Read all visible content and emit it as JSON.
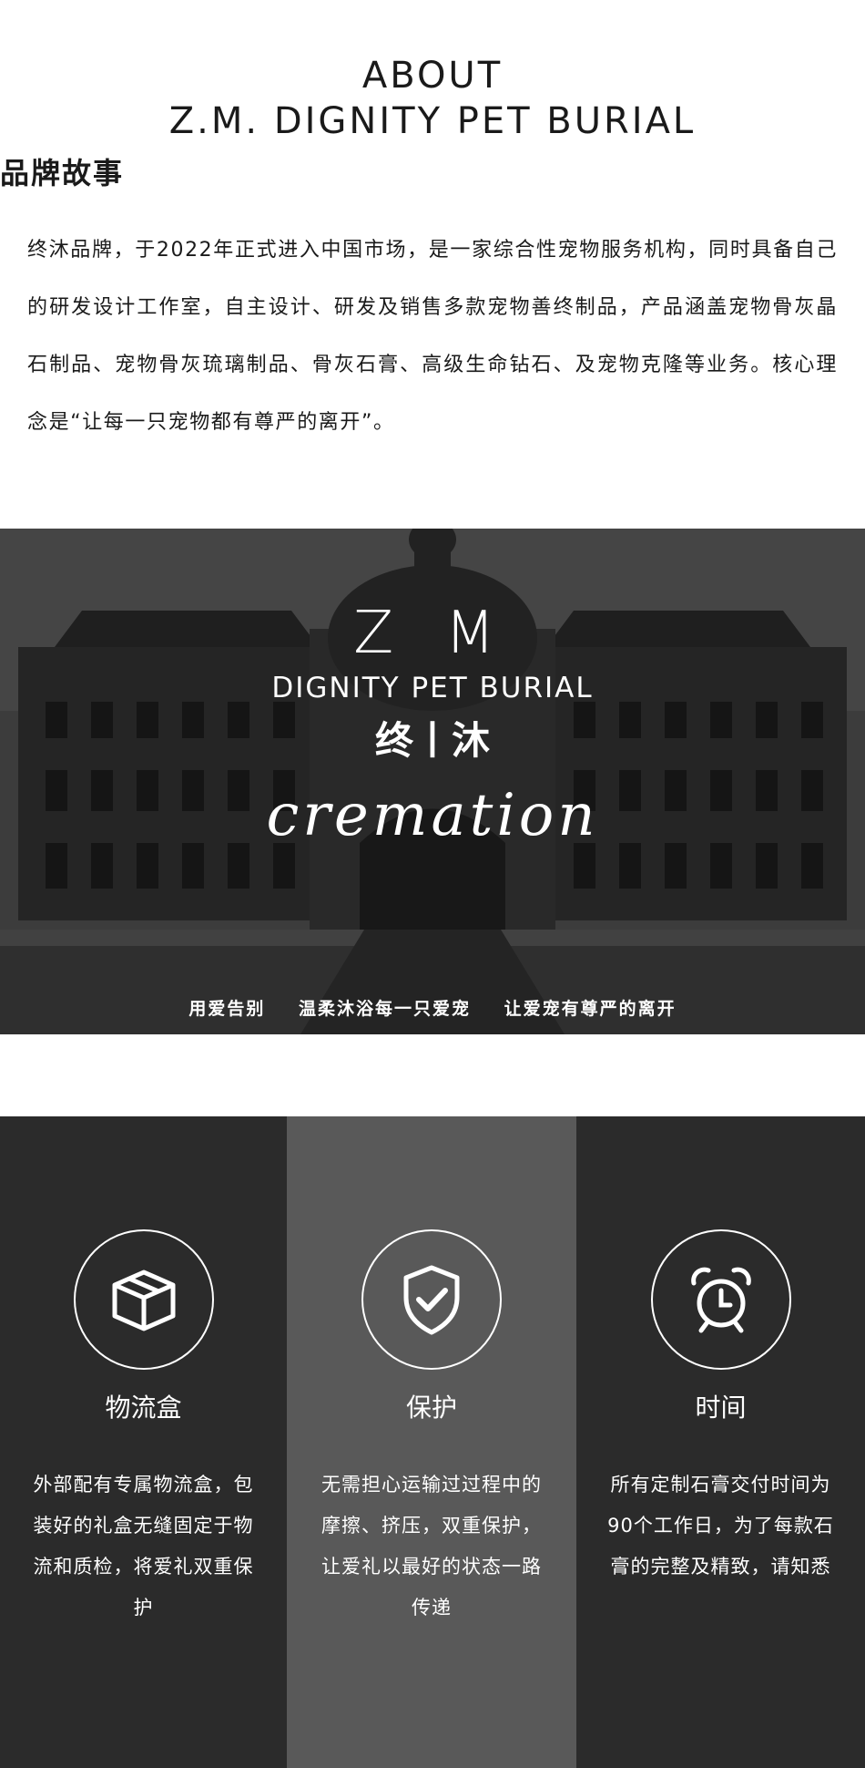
{
  "header": {
    "title_line1": "ABOUT",
    "title_line2": "Z.M. DIGNITY PET BURIAL",
    "title_cn": "品牌故事"
  },
  "intro": {
    "paragraph": "终沐品牌，于2022年正式进入中国市场，是一家综合性宠物服务机构，同时具备自己的研发设计工作室，自主设计、研发及销售多款宠物善终制品，产品涵盖宠物骨灰晶石制品、宠物骨灰琉璃制品、骨灰石膏、高级生命钻石、及宠物克隆等业务。核心理念是“让每一只宠物都有尊严的离开”。"
  },
  "banner": {
    "logo_zm": "Z M",
    "logo_en": "DIGNITY PET BURIAL",
    "logo_cn": "终丨沐",
    "logo_script": "cremation",
    "slogans": [
      "用爱告别",
      "温柔沐浴每一只爱宠",
      "让爱宠有尊严的离开"
    ]
  },
  "features": [
    {
      "icon": "box-icon",
      "title": "物流盒",
      "text": "外部配有专属物流盒，包装好的礼盒无缝固定于物流和质检，将爱礼双重保护"
    },
    {
      "icon": "shield-check-icon",
      "title": "保护",
      "text": "无需担心运输过过程中的摩擦、挤压，双重保护，让爱礼以最好的状态一路传递"
    },
    {
      "icon": "alarm-clock-icon",
      "title": "时间",
      "text": "所有定制石膏交付时间为90个工作日，为了每款石膏的完整及精致，请知悉"
    }
  ],
  "colors": {
    "dark_column": "#2b2b2b",
    "mid_column": "#595959",
    "text": "#1a1a1a",
    "banner_overlay": "#3e3e3e"
  }
}
